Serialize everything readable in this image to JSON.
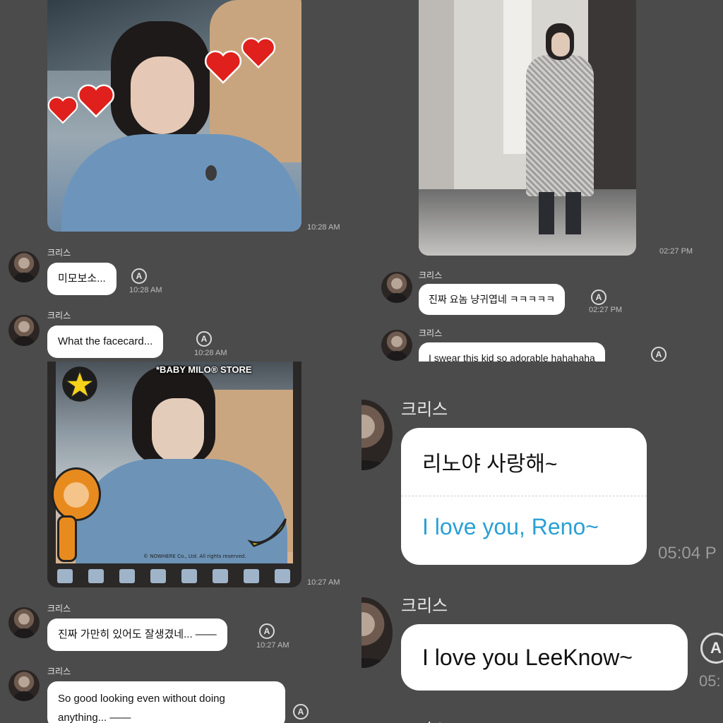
{
  "sender_name": "크리스",
  "panel1": {
    "photo_time": "10:28 AM",
    "messages": [
      {
        "text": "미모보소...",
        "time": "10:28 AM"
      },
      {
        "text": "What the facecard...",
        "time": "10:28 AM"
      }
    ]
  },
  "panel2": {
    "photo_time": "02:27 PM",
    "messages": [
      {
        "text": "진짜 요놈 냥귀엽네 ㅋㅋㅋㅋㅋ",
        "time": "02:27 PM"
      },
      {
        "text": "I swear this kid so adorable hahahaha"
      }
    ]
  },
  "panel3": {
    "sticker_label": "*BABY MILO® STORE",
    "copyright": "© NOWHERE Co., Ltd. All rights reserved.",
    "photo_time": "10:27 AM",
    "messages": [
      {
        "text": "진짜 가만히 있어도 잘생겼네... ——",
        "time": "10:27 AM"
      },
      {
        "text_line1": "So good looking even without doing",
        "text_line2": "anything... ——"
      }
    ]
  },
  "panel4": {
    "message1": {
      "original": "리노야 사랑해~",
      "translated": "I love you, Reno~",
      "time": "05:04 P"
    },
    "message2": {
      "text": "I love you LeeKnow~",
      "time": "05:"
    }
  },
  "icons": {
    "translate": "translate-icon",
    "heart": "heart-icon",
    "star": "star-icon",
    "banana": "banana-icon"
  },
  "colors": {
    "background": "#4b4b4b",
    "bubble": "#ffffff",
    "translation": "#2a9fd6",
    "heart": "#e0201c"
  }
}
